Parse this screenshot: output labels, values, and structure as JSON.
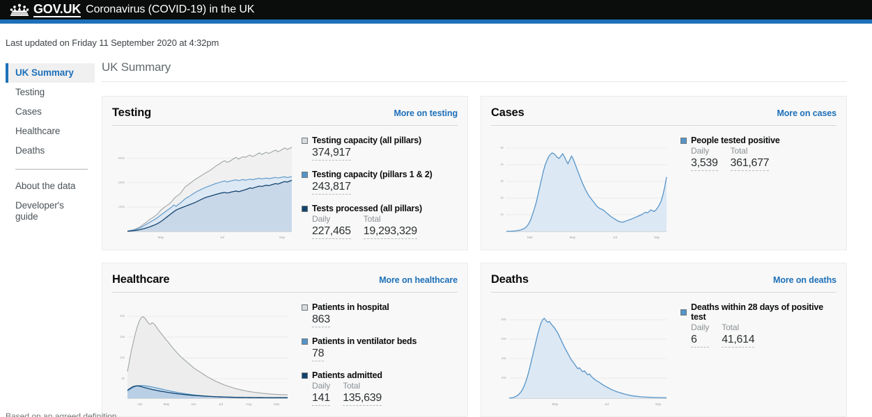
{
  "header": {
    "brand": "GOV.UK",
    "service_name": "Coronavirus (COVID-19) in the UK",
    "crown_icon": "crown-icon",
    "bar_color": "#1d70b8"
  },
  "last_updated": "Last updated on Friday 11 September 2020 at 4:32pm",
  "sidebar": {
    "items": [
      {
        "label": "UK Summary",
        "active": true
      },
      {
        "label": "Testing",
        "active": false
      },
      {
        "label": "Cases",
        "active": false
      },
      {
        "label": "Healthcare",
        "active": false
      },
      {
        "label": "Deaths",
        "active": false
      }
    ],
    "secondary_items": [
      {
        "label": "About the data"
      },
      {
        "label": "Developer's guide"
      }
    ]
  },
  "page_title": "UK Summary",
  "footnote": "Based on an agreed definition",
  "colors": {
    "line_grey": "#9fa5a8",
    "line_mid_blue": "#5694c8",
    "line_dark_blue": "#12436d",
    "fill_pale_blue": "#dce8f4",
    "fill_grey": "#ececec",
    "link_blue": "#1d70b8"
  },
  "cards": [
    {
      "id": "testing",
      "title": "Testing",
      "link": "More on testing",
      "stats": [
        {
          "label": "Testing capacity (all pillars)",
          "marker_color": "#d8dbdd",
          "values": [
            {
              "caption": "",
              "number": "374,917"
            }
          ]
        },
        {
          "label": "Testing capacity (pillars 1 & 2)",
          "marker_color": "#5694c8",
          "values": [
            {
              "caption": "",
              "number": "243,817"
            }
          ]
        },
        {
          "label": "Tests processed (all pillars)",
          "marker_color": "#12436d",
          "values": [
            {
              "caption": "Daily",
              "number": "227,465"
            },
            {
              "caption": "Total",
              "number": "19,293,329"
            }
          ]
        }
      ]
    },
    {
      "id": "cases",
      "title": "Cases",
      "link": "More on cases",
      "stats": [
        {
          "label": "People tested positive",
          "marker_color": "#5694c8",
          "values": [
            {
              "caption": "Daily",
              "number": "3,539"
            },
            {
              "caption": "Total",
              "number": "361,677"
            }
          ]
        }
      ]
    },
    {
      "id": "healthcare",
      "title": "Healthcare",
      "link": "More on healthcare",
      "stats": [
        {
          "label": "Patients in hospital",
          "marker_color": "#d8dbdd",
          "values": [
            {
              "caption": "",
              "number": "863"
            }
          ]
        },
        {
          "label": "Patients in ventilator beds",
          "marker_color": "#5694c8",
          "values": [
            {
              "caption": "",
              "number": "78"
            }
          ]
        },
        {
          "label": "Patients admitted",
          "marker_color": "#12436d",
          "values": [
            {
              "caption": "Daily",
              "number": "141"
            },
            {
              "caption": "Total",
              "number": "135,639"
            }
          ]
        }
      ]
    },
    {
      "id": "deaths",
      "title": "Deaths",
      "link": "More on deaths",
      "stats": [
        {
          "label": "Deaths within 28 days of positive test",
          "marker_color": "#5694c8",
          "values": [
            {
              "caption": "Daily",
              "number": "6"
            },
            {
              "caption": "Total",
              "number": "41,614"
            }
          ]
        }
      ]
    }
  ],
  "chart_data": [
    {
      "id": "testing",
      "type": "area",
      "title": "Testing",
      "xlabel": "",
      "ylabel": "",
      "grid": true,
      "legend_position": "right",
      "ylim": [
        0,
        390000
      ],
      "yticks": [
        100000,
        200000,
        300000
      ],
      "ytick_labels": [
        "100k",
        "200k",
        "300k"
      ],
      "xticks": [
        "May",
        "Jul",
        "Sep"
      ],
      "series": [
        {
          "name": "Testing capacity (all pillars)",
          "color": "#9fa5a8",
          "values": [
            2000,
            4000,
            6000,
            9000,
            13000,
            18000,
            25000,
            33000,
            40000,
            48000,
            56000,
            62000,
            70000,
            78000,
            90000,
            100000,
            108000,
            115000,
            122000,
            131000,
            145000,
            155000,
            162000,
            171000,
            186000,
            199000,
            206000,
            214000,
            222000,
            230000,
            236000,
            243000,
            249000,
            256000,
            262000,
            268000,
            274000,
            282000,
            290000,
            296000,
            303000,
            310000,
            315000,
            308000,
            312000,
            318000,
            325000,
            330000,
            322000,
            328000,
            333000,
            330000,
            336000,
            340000,
            333000,
            338000,
            344000,
            350000,
            343000,
            348000,
            353000,
            347000,
            352000,
            358000,
            362000,
            355000,
            360000,
            366000,
            372000,
            365000,
            370000,
            375000
          ]
        },
        {
          "name": "Testing capacity (pillars 1 & 2)",
          "color": "#5694c8",
          "values": [
            1500,
            3000,
            5000,
            7000,
            10000,
            14000,
            19000,
            25000,
            31000,
            37000,
            43000,
            49000,
            55000,
            62000,
            70000,
            78000,
            85000,
            93000,
            100000,
            108000,
            118000,
            112000,
            120000,
            128000,
            137000,
            146000,
            152000,
            158000,
            165000,
            172000,
            178000,
            183000,
            188000,
            193000,
            197000,
            201000,
            205000,
            209000,
            213000,
            216000,
            219000,
            222000,
            225000,
            220000,
            223000,
            226000,
            228000,
            230000,
            226000,
            229000,
            231000,
            228000,
            231000,
            233000,
            230000,
            233000,
            235000,
            237000,
            234000,
            236000,
            238000,
            235000,
            237000,
            239000,
            241000,
            238000,
            240000,
            242000,
            243000,
            240000,
            242000,
            243817
          ]
        },
        {
          "name": "Tests processed (all pillars)",
          "color": "#12436d",
          "values": [
            800,
            1600,
            2600,
            3800,
            5200,
            7000,
            9500,
            12000,
            15000,
            18000,
            22000,
            26000,
            30000,
            35000,
            41000,
            48000,
            56000,
            64000,
            72000,
            80000,
            88000,
            95000,
            100000,
            104000,
            108000,
            112000,
            116000,
            120000,
            124000,
            128000,
            133000,
            138000,
            143000,
            148000,
            152000,
            155000,
            158000,
            161000,
            164000,
            167000,
            170000,
            172000,
            174000,
            171000,
            173000,
            176000,
            178000,
            180000,
            177000,
            180000,
            183000,
            186000,
            190000,
            194000,
            192000,
            196000,
            199000,
            202000,
            200000,
            203000,
            206000,
            204000,
            207000,
            210000,
            213000,
            211000,
            215000,
            219000,
            222000,
            220000,
            224000,
            227465
          ]
        }
      ]
    },
    {
      "id": "cases",
      "type": "area",
      "title": "Cases",
      "xlabel": "",
      "ylabel": "",
      "grid": true,
      "legend_position": "right",
      "ylim": [
        0,
        5600
      ],
      "yticks": [
        1000,
        2000,
        3000,
        4000,
        5000
      ],
      "ytick_labels": [
        "1k",
        "2k",
        "3k",
        "4k",
        "5k"
      ],
      "xticks": [
        "Mar",
        "May",
        "Jul",
        "Sep"
      ],
      "series": [
        {
          "name": "People tested positive",
          "color": "#5694c8",
          "values": [
            5,
            8,
            12,
            18,
            25,
            35,
            50,
            70,
            95,
            130,
            180,
            260,
            380,
            560,
            820,
            1150,
            1500,
            1900,
            2400,
            2900,
            3400,
            3900,
            4300,
            4600,
            4850,
            5000,
            5100,
            5050,
            4950,
            4800,
            4750,
            4900,
            5050,
            4850,
            4600,
            4400,
            4650,
            4900,
            4700,
            4400,
            4100,
            3800,
            3500,
            3200,
            2950,
            2700,
            2500,
            2300,
            2150,
            2000,
            1850,
            1700,
            1580,
            1500,
            1450,
            1400,
            1300,
            1200,
            1100,
            1000,
            920,
            850,
            780,
            700,
            650,
            620,
            600,
            640,
            680,
            720,
            760,
            800,
            850,
            900,
            950,
            1000,
            1050,
            1100,
            1180,
            1250,
            1200,
            1280,
            1400,
            1350,
            1300,
            1400,
            1550,
            1750,
            2000,
            2400,
            2900,
            3539
          ]
        }
      ]
    },
    {
      "id": "healthcare",
      "type": "area",
      "title": "Healthcare",
      "xlabel": "",
      "ylabel": "",
      "grid": true,
      "legend_position": "right",
      "ylim": [
        0,
        21000
      ],
      "yticks": [
        5000,
        10000,
        15000,
        20000
      ],
      "ytick_labels": [
        "5k",
        "10k",
        "15k",
        "20k"
      ],
      "xticks": [
        "Apr",
        "May",
        "Jun",
        "Jul",
        "Aug",
        "Sep"
      ],
      "series": [
        {
          "name": "Patients in hospital",
          "color": "#9fa5a8",
          "values": [
            6500,
            9000,
            11500,
            13500,
            15500,
            17200,
            18600,
            19500,
            19900,
            19600,
            19000,
            18300,
            18000,
            18400,
            18100,
            17500,
            16800,
            16200,
            15600,
            15000,
            14400,
            13900,
            13300,
            12700,
            12100,
            11600,
            11100,
            10600,
            10100,
            9700,
            9300,
            8900,
            8500,
            8100,
            7700,
            7300,
            7000,
            6700,
            6400,
            6100,
            5800,
            5500,
            5200,
            4950,
            4700,
            4450,
            4200,
            4000,
            3800,
            3600,
            3400,
            3200,
            3050,
            2900,
            2750,
            2600,
            2450,
            2300,
            2200,
            2100,
            2000,
            1900,
            1800,
            1700,
            1620,
            1550,
            1480,
            1420,
            1360,
            1300,
            1250,
            1200,
            1150,
            1110,
            1070,
            1030,
            1000,
            970,
            940,
            920,
            900,
            885,
            875,
            868,
            863
          ]
        },
        {
          "name": "Patients in ventilator beds",
          "color": "#5694c8",
          "values": [
            1800,
            2100,
            2400,
            2650,
            2850,
            3000,
            3080,
            3120,
            3100,
            3050,
            2980,
            2900,
            2820,
            2730,
            2640,
            2540,
            2440,
            2330,
            2220,
            2110,
            2000,
            1900,
            1800,
            1700,
            1610,
            1520,
            1430,
            1350,
            1270,
            1190,
            1120,
            1050,
            980,
            920,
            860,
            800,
            750,
            700,
            655,
            610,
            570,
            530,
            495,
            460,
            430,
            400,
            372,
            346,
            322,
            300,
            280,
            262,
            245,
            230,
            215,
            202,
            190,
            180,
            170,
            162,
            154,
            147,
            140,
            134,
            128,
            123,
            118,
            114,
            110,
            106,
            102,
            99,
            96,
            93,
            90,
            88,
            86,
            84,
            82,
            81,
            80,
            79,
            78,
            78,
            78
          ]
        },
        {
          "name": "Patients admitted",
          "color": "#12436d",
          "values": [
            1900,
            2300,
            2600,
            2850,
            2980,
            3020,
            2950,
            2830,
            2700,
            2570,
            2450,
            2330,
            2210,
            2100,
            2000,
            1900,
            1810,
            1720,
            1640,
            1560,
            1480,
            1400,
            1330,
            1260,
            1190,
            1130,
            1070,
            1010,
            960,
            910,
            860,
            815,
            770,
            730,
            690,
            655,
            620,
            588,
            558,
            528,
            500,
            474,
            450,
            427,
            405,
            384,
            365,
            347,
            330,
            314,
            299,
            285,
            272,
            260,
            248,
            237,
            227,
            218,
            210,
            202,
            195,
            189,
            183,
            178,
            173,
            169,
            165,
            161,
            158,
            155,
            152,
            150,
            148,
            146,
            145,
            144,
            143,
            142,
            141,
            141,
            141,
            141,
            141
          ]
        }
      ]
    },
    {
      "id": "deaths",
      "type": "area",
      "title": "Deaths",
      "xlabel": "",
      "ylabel": "",
      "grid": true,
      "legend_position": "right",
      "ylim": [
        0,
        960
      ],
      "yticks": [
        200,
        400,
        600,
        800
      ],
      "ytick_labels": [
        "200",
        "400",
        "600",
        "800"
      ],
      "xticks": [
        "May",
        "Jul",
        "Sep"
      ],
      "series": [
        {
          "name": "Deaths within 28 days of positive test",
          "color": "#5694c8",
          "values": [
            2,
            4,
            7,
            12,
            20,
            32,
            48,
            70,
            100,
            140,
            190,
            250,
            320,
            400,
            480,
            560,
            640,
            720,
            790,
            850,
            890,
            905,
            880,
            860,
            870,
            845,
            820,
            800,
            770,
            740,
            700,
            660,
            620,
            580,
            545,
            510,
            475,
            440,
            415,
            390,
            360,
            335,
            345,
            320,
            300,
            310,
            285,
            265,
            275,
            250,
            230,
            215,
            200,
            190,
            178,
            165,
            152,
            140,
            130,
            120,
            110,
            100,
            92,
            84,
            76,
            70,
            64,
            58,
            52,
            47,
            42,
            38,
            34,
            30,
            27,
            24,
            22,
            20,
            18,
            16,
            15,
            14,
            13,
            12,
            11,
            10,
            9,
            9,
            8,
            8,
            7,
            7,
            6,
            6,
            6
          ]
        }
      ]
    }
  ]
}
